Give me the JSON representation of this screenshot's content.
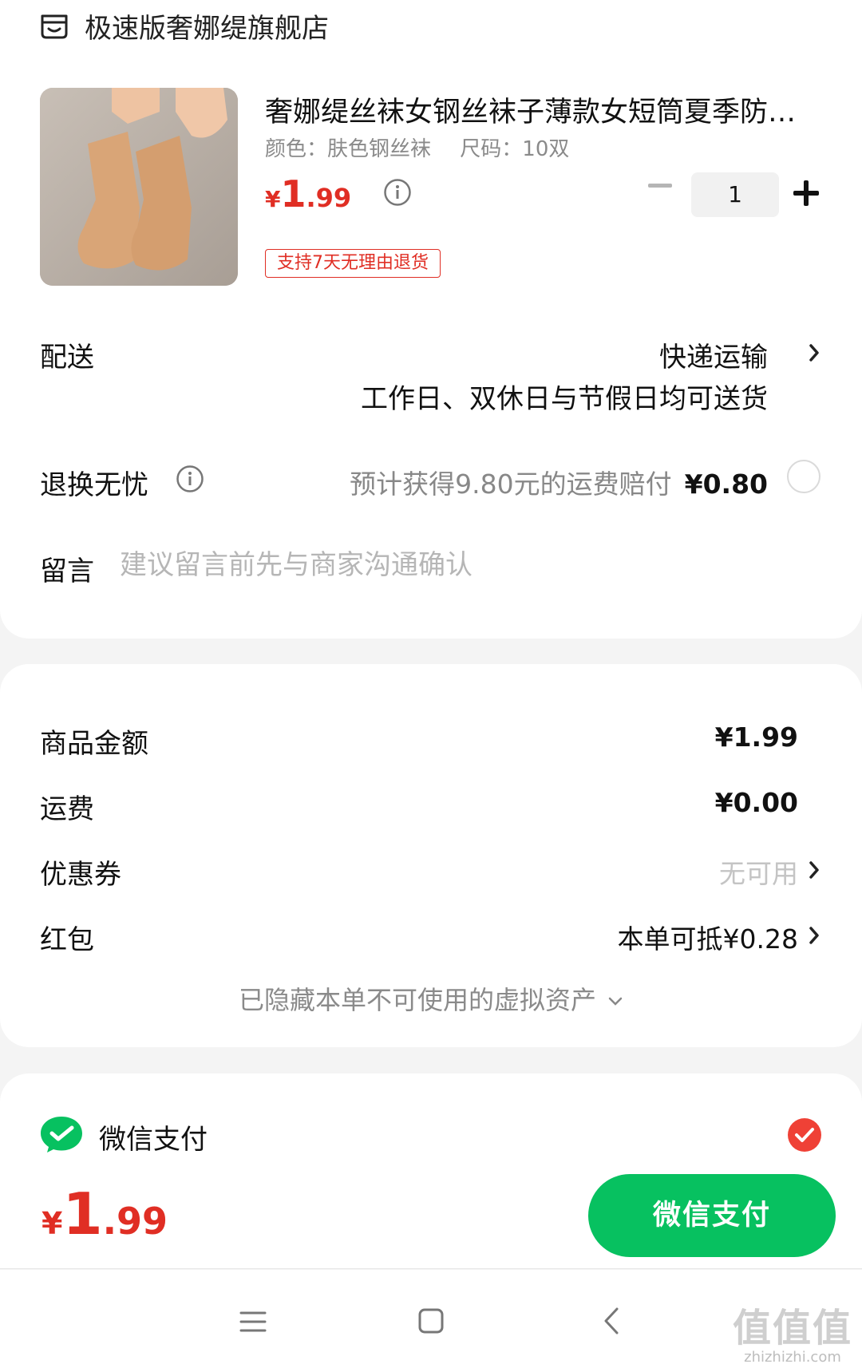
{
  "store": {
    "name": "极速版奢娜缇旗舰店",
    "icon": "store-icon"
  },
  "product": {
    "title": "奢娜缇丝袜女钢丝袜子薄款女短筒夏季防…",
    "color_spec": "颜色：肤色钢丝袜",
    "size_spec": "尺码：10双",
    "price_symbol": "¥",
    "price_int": "1",
    "price_dec": ".99",
    "quantity": "1",
    "badge": "支持7天无理由退货"
  },
  "delivery": {
    "label": "配送",
    "value": "快递运输",
    "sub": "工作日、双休日与节假日均可送货"
  },
  "returns": {
    "label": "退换无忧",
    "desc": "预计获得9.80元的运费赔付",
    "price": "¥0.80"
  },
  "message": {
    "label": "留言",
    "placeholder": "建议留言前先与商家沟通确认"
  },
  "summary": {
    "goods_label": "商品金额",
    "goods_value": "¥1.99",
    "shipping_label": "运费",
    "shipping_value": "¥0.00",
    "coupon_label": "优惠券",
    "coupon_value": "无可用",
    "redpacket_label": "红包",
    "redpacket_value": "本单可抵¥0.28",
    "hidden_note": "已隐藏本单不可使用的虚拟资产"
  },
  "payment": {
    "method": "微信支付"
  },
  "checkout": {
    "symbol": "¥",
    "int": "1",
    "dec": ".99",
    "button": "微信支付"
  },
  "watermark": {
    "big": "值值值",
    "small": "zhizhizhi.com"
  },
  "colors": {
    "accent_red": "#e02e24",
    "wechat_green": "#07c160",
    "check_red": "#ef4136"
  }
}
